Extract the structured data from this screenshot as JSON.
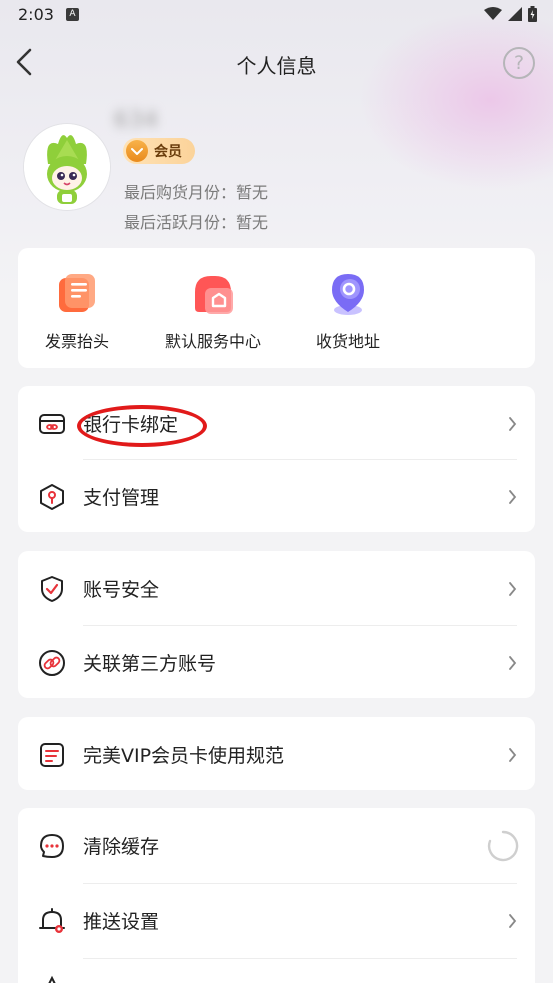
{
  "status_bar": {
    "time": "2:03",
    "notification_glyph": "A"
  },
  "header": {
    "title": "个人信息",
    "help_glyph": "?"
  },
  "profile": {
    "username_blurred": "634",
    "member_badge": "会员",
    "last_purchase": "最后购货月份：暂无",
    "last_active": "最后活跃月份：暂无"
  },
  "quick_actions": [
    {
      "label": "发票抬头",
      "icon": "invoice-icon",
      "color": "#ff6b3d"
    },
    {
      "label": "默认服务中心",
      "icon": "service-center-icon",
      "color": "#ff5656"
    },
    {
      "label": "收货地址",
      "icon": "location-icon",
      "color": "#7a6cf5"
    }
  ],
  "groups": [
    {
      "items": [
        {
          "label": "银行卡绑定",
          "icon": "bank-card-icon",
          "action": "arrow"
        },
        {
          "label": "支付管理",
          "icon": "payment-icon",
          "action": "arrow"
        }
      ]
    },
    {
      "items": [
        {
          "label": "账号安全",
          "icon": "shield-icon",
          "action": "arrow"
        },
        {
          "label": "关联第三方账号",
          "icon": "link-icon",
          "action": "arrow"
        }
      ]
    },
    {
      "items": [
        {
          "label": "完美VIP会员卡使用规范",
          "icon": "document-icon",
          "action": "arrow"
        }
      ]
    },
    {
      "items": [
        {
          "label": "清除缓存",
          "icon": "chat-dots-icon",
          "action": "spinner"
        },
        {
          "label": "推送设置",
          "icon": "bell-icon",
          "action": "arrow"
        }
      ]
    }
  ],
  "colors": {
    "accent_red": "#e8333a",
    "annotation": "#e11a1a"
  }
}
